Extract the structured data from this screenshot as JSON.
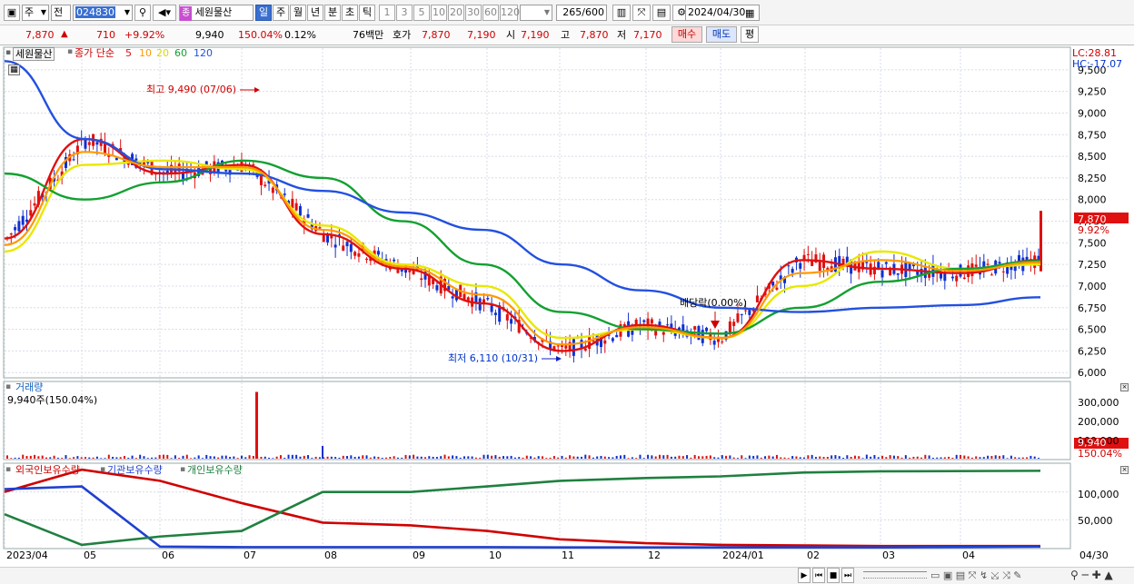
{
  "toolbar": {
    "type_label": "주",
    "all_label": "전",
    "code": "024830",
    "stock_tag": "종",
    "stock_name": "세원물산",
    "periods": [
      "일",
      "주",
      "월",
      "년",
      "분",
      "초",
      "틱"
    ],
    "active_period": "일",
    "intervals": [
      "1",
      "3",
      "5",
      "10",
      "20",
      "30",
      "60",
      "120"
    ],
    "count_value": "265",
    "count_total": "/600",
    "date": "2024/04/30"
  },
  "quote": {
    "price": "7,870",
    "change": "710",
    "change_pct": "+9.92%",
    "volume": "9,940",
    "volume_ratio": "150.04%",
    "turnover": "0.12%",
    "amount": "76백만",
    "ask_label": "호가",
    "ask": "7,870",
    "ask2": "7,190",
    "open_label": "시",
    "open": "7,190",
    "high_label": "고",
    "high": "7,870",
    "low_label": "저",
    "low": "7,170",
    "buy_label": "매수",
    "sell_label": "매도",
    "avg_label": "평"
  },
  "price_panel": {
    "stock_name": "세원물산",
    "legend_prefix": "종가 단순",
    "ma_labels": [
      "5",
      "10",
      "20",
      "60",
      "120"
    ],
    "ma_colors": [
      "#e01010",
      "#ff9900",
      "#e8e800",
      "#13a030",
      "#2350e0"
    ],
    "lc": "LC:28.81",
    "hc": "HC:-17.07",
    "last_price": "7,870",
    "last_pct": "9.92%",
    "high_annotation": "최고 9,490 (07/06)",
    "low_annotation": "최저 6,110 (10/31)",
    "dividend_annotation": "배당락(0.00%)"
  },
  "volume_panel": {
    "title": "거래량",
    "summary": "9,940주(150.04%)",
    "last_volume": "9,940",
    "last_pct": "150.04%",
    "y_ticks": [
      "300,000",
      "200,000",
      "100,000"
    ]
  },
  "holdings_panel": {
    "legend": [
      "외국인보유수량",
      "기관보유수량",
      "개인보유수량"
    ],
    "legend_colors": [
      "#d00000",
      "#2040d0",
      "#208040"
    ],
    "y_ticks": [
      "100,000",
      "50,000"
    ]
  },
  "x_axis": {
    "labels": [
      "2023/04",
      "05",
      "06",
      "07",
      "08",
      "09",
      "10",
      "11",
      "12",
      "2024/01",
      "02",
      "03",
      "04"
    ],
    "right_label": "04/30"
  },
  "chart_data": {
    "type": "line",
    "price_axis": {
      "ticks": [
        6000,
        6250,
        6500,
        6750,
        7000,
        7250,
        7500,
        7750,
        8000,
        8250,
        8500,
        8750,
        9000,
        9250,
        9500
      ],
      "ylim": [
        5950,
        9750
      ]
    },
    "candle_type": "candlestick",
    "series": [
      {
        "name": "5",
        "x": [
          "2023/04",
          "05",
          "06",
          "07",
          "08",
          "09",
          "10",
          "11",
          "12",
          "2024/01",
          "02",
          "03",
          "04",
          "04/30"
        ],
        "values": [
          7550,
          8700,
          8300,
          8400,
          7600,
          7200,
          6800,
          6250,
          6550,
          6400,
          7300,
          7200,
          7150,
          7300
        ]
      },
      {
        "name": "20",
        "x": [
          "2023/04",
          "05",
          "06",
          "07",
          "08",
          "09",
          "10",
          "11",
          "12",
          "2024/01",
          "02",
          "03",
          "04",
          "04/30"
        ],
        "values": [
          7400,
          8400,
          8450,
          8350,
          7700,
          7250,
          7000,
          6400,
          6500,
          6400,
          7000,
          7400,
          7200,
          7250
        ]
      },
      {
        "name": "60",
        "x": [
          "2023/04",
          "05",
          "06",
          "07",
          "08",
          "09",
          "10",
          "11",
          "12",
          "2024/01",
          "02",
          "03",
          "04",
          "04/30"
        ],
        "values": [
          8300,
          8000,
          8200,
          8450,
          8250,
          7750,
          7250,
          6700,
          6500,
          6450,
          6750,
          7050,
          7200,
          7290
        ]
      },
      {
        "name": "120",
        "x": [
          "2023/04",
          "05",
          "06",
          "07",
          "08",
          "09",
          "10",
          "11",
          "12",
          "2024/01",
          "02",
          "03",
          "04",
          "04/30"
        ],
        "values": [
          9600,
          8700,
          8350,
          8300,
          8100,
          7850,
          7650,
          7250,
          6950,
          6750,
          6700,
          6750,
          6780,
          6870
        ]
      }
    ],
    "volume": {
      "peak": 350000,
      "peak_date": "07/06",
      "last": 9940
    },
    "holdings": {
      "ylim": [
        0,
        150000
      ],
      "series": [
        {
          "name": "외국인보유수량",
          "values": [
            100000,
            140000,
            120000,
            80000,
            45000,
            40000,
            30000,
            15000,
            8000,
            5000,
            4000,
            3000,
            3000
          ]
        },
        {
          "name": "기관보유수량",
          "values": [
            105000,
            110000,
            2000,
            1000,
            1000,
            1000,
            1000,
            500,
            500,
            500,
            500,
            500,
            2000
          ]
        },
        {
          "name": "개인보유수량",
          "values": [
            60000,
            5000,
            20000,
            30000,
            100000,
            100000,
            110000,
            120000,
            125000,
            128000,
            135000,
            137000,
            138000
          ]
        }
      ]
    }
  }
}
